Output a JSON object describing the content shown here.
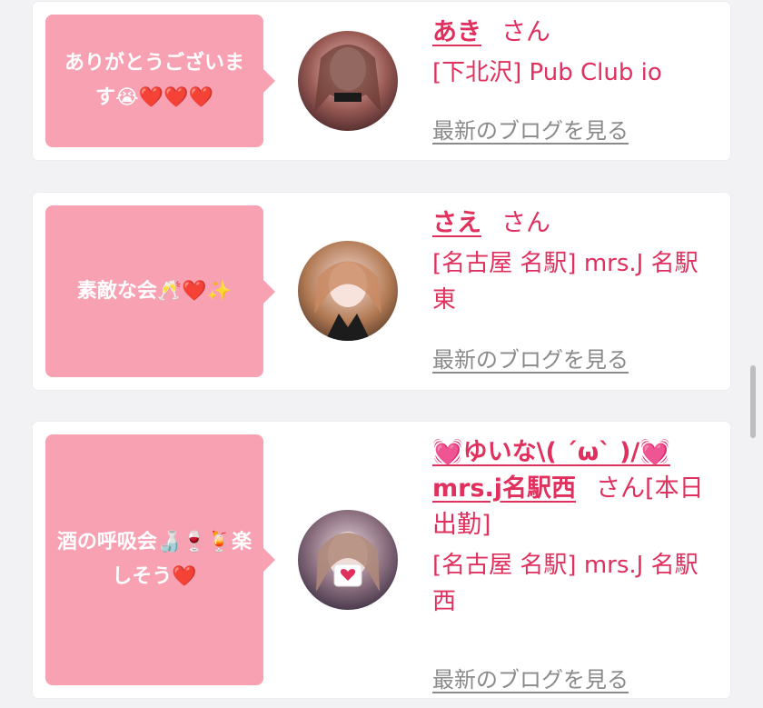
{
  "entries": [
    {
      "message": "ありがとうございます😭❤️❤️❤️",
      "name": "あき",
      "suffix": "さん",
      "shop": "[下北沢] Pub Club io",
      "blog_link": "最新のブログを見る"
    },
    {
      "message": "素敵な会🥂❤️✨",
      "name": "さえ",
      "suffix": "さん",
      "shop": "[名古屋 名駅] mrs.J 名駅東",
      "blog_link": "最新のブログを見る"
    },
    {
      "message": "酒の呼吸会🍶🍷🍹楽しそう❤️",
      "name": "💓ゆいな\\( ´ω` )/💓mrs.j名駅西",
      "suffix": "さん[本日出勤]",
      "shop": "[名古屋 名駅] mrs.J 名駅西",
      "blog_link": "最新のブログを見る"
    }
  ],
  "colors": {
    "accent": "#e0305e",
    "bubble": "#f7a1b2",
    "muted": "#8a8a8a",
    "background": "#f2f2f4"
  }
}
